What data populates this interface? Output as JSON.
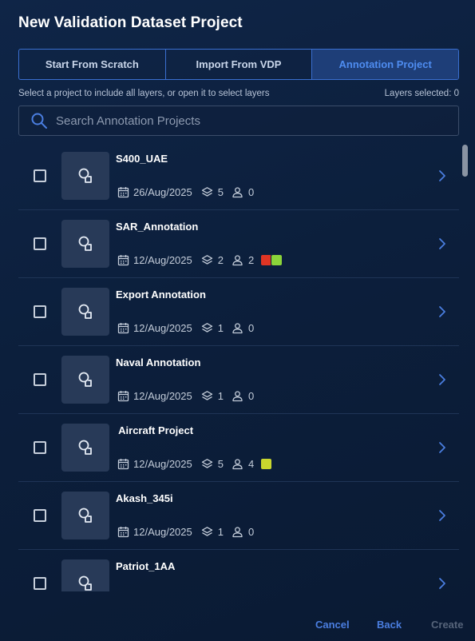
{
  "dialog": {
    "title": "New Validation Dataset Project",
    "tabs": [
      {
        "label": "Start From Scratch",
        "active": false
      },
      {
        "label": "Import From VDP",
        "active": false
      },
      {
        "label": "Annotation Project",
        "active": true
      }
    ],
    "hint": "Select a project to include all layers, or open it to select layers",
    "layers_selected_label": "Layers selected: 0",
    "search": {
      "placeholder": "Search Annotation Projects",
      "value": ""
    }
  },
  "colors": {
    "accent": "#4a7ee0",
    "status_red": "#e03524",
    "status_green": "#8bd43a",
    "status_yellow": "#c9d62e"
  },
  "projects": [
    {
      "name": "S400_UAE",
      "date": "26/Aug/2025",
      "layers": "5",
      "users": "0",
      "status_colors": []
    },
    {
      "name": "SAR_Annotation",
      "date": "12/Aug/2025",
      "layers": "2",
      "users": "2",
      "status_colors": [
        "#e03524",
        "#8bd43a"
      ]
    },
    {
      "name": "Export Annotation",
      "date": "12/Aug/2025",
      "layers": "1",
      "users": "0",
      "status_colors": []
    },
    {
      "name": "Naval Annotation",
      "date": "12/Aug/2025",
      "layers": "1",
      "users": "0",
      "status_colors": []
    },
    {
      "name": " Aircraft Project",
      "date": "12/Aug/2025",
      "layers": "5",
      "users": "4",
      "status_colors": [
        "#c9d62e"
      ]
    },
    {
      "name": "Akash_345i",
      "date": "12/Aug/2025",
      "layers": "1",
      "users": "0",
      "status_colors": []
    },
    {
      "name": "Patriot_1AA",
      "date": "",
      "layers": "",
      "users": "",
      "status_colors": []
    }
  ],
  "icons": {
    "search": "search-icon",
    "project": "project-icon",
    "calendar": "calendar-icon",
    "layers": "layers-icon",
    "user": "user-icon",
    "chevron": "chevron-right-icon"
  },
  "footer": {
    "cancel_label": "Cancel",
    "back_label": "Back",
    "create_label": "Create"
  }
}
